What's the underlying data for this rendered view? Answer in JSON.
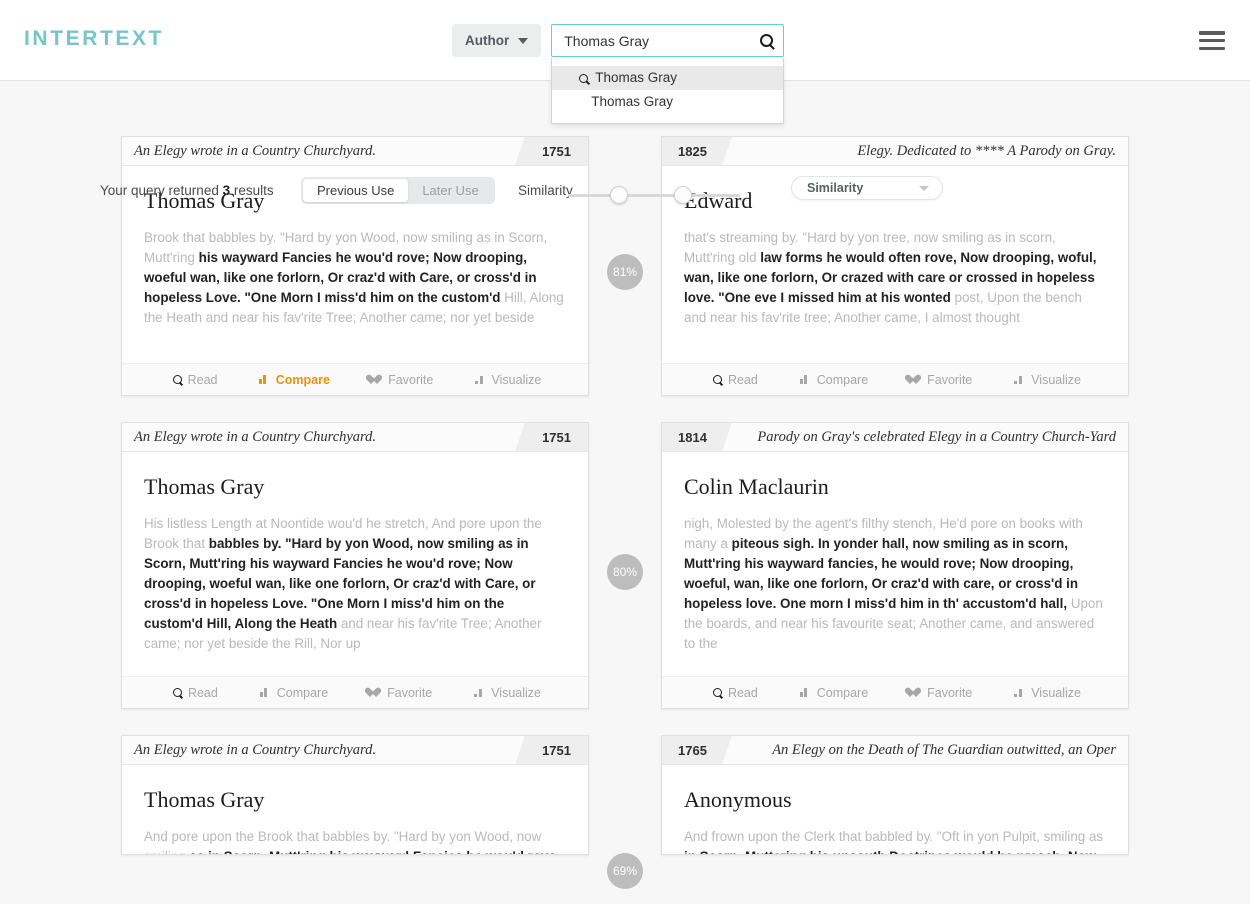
{
  "header": {
    "logo": "INTERTEXT",
    "author_filter_label": "Author",
    "search_value": "Thomas Gray",
    "search_placeholder": "Search",
    "search_icon": "search-icon",
    "menu_icon": "hamburger-menu-icon",
    "suggestions": [
      {
        "label": "Thomas Gray",
        "icon": "search-icon",
        "active": true
      },
      {
        "label": "Thomas Gray",
        "icon": "",
        "active": false
      }
    ]
  },
  "toolbar": {
    "results_prefix": "Your query returned",
    "results_count": "3",
    "results_suffix": "results",
    "toggle": {
      "previous_label": "Previous Use",
      "later_label": "Later Use",
      "selected": "Previous Use"
    },
    "similarity_label": "Similarity",
    "sort_value": "Similarity"
  },
  "colors": {
    "brand": "#76c5cd",
    "accent": "#e8930a",
    "badge": "#bdbdbd",
    "focus_border": "#63cfd8"
  },
  "actions": {
    "read": "Read",
    "compare": "Compare",
    "favorite": "Favorite",
    "visualize": "Visualize"
  },
  "results": [
    {
      "score": "81%",
      "left": {
        "title": "An Elegy wrote in a Country Churchyard.",
        "year": "1751",
        "author": "Thomas Gray",
        "excerpt": [
          {
            "t": "Brook that babbles by. \"Hard by yon Wood, now smiling as in Scorn, Mutt'ring ",
            "b": false
          },
          {
            "t": "his wayward Fancies he wou'd rove; Now drooping, woeful wan, like one forlorn, Or craz'd with Care, or cross'd in hopeless Love. \"One Morn I miss'd him on the custom'd",
            "b": true
          },
          {
            "t": " Hill, Along the Heath and near his fav'rite Tree; Another came; nor yet beside",
            "b": false
          }
        ],
        "compare_active": true
      },
      "right": {
        "title": "Elegy. Dedicated to **** A Parody on Gray.",
        "year": "1825",
        "author": "Edward",
        "excerpt": [
          {
            "t": "that's streaming by. \"Hard by yon tree, now smiling as in scorn, Mutt'ring old ",
            "b": false
          },
          {
            "t": "law forms he would often rove, Now drooping, woful, wan, like one forlorn, Or crazed with care or crossed in hopeless love. \"One eve I missed him at his wonted",
            "b": true
          },
          {
            "t": " post, Upon the bench and near his fav'rite tree; Another came, I almost thought",
            "b": false
          }
        ],
        "compare_active": false
      }
    },
    {
      "score": "80%",
      "left": {
        "title": "An Elegy wrote in a Country Churchyard.",
        "year": "1751",
        "author": "Thomas Gray",
        "excerpt": [
          {
            "t": "His listless Length at Noontide wou'd he stretch, And pore upon the Brook that ",
            "b": false
          },
          {
            "t": "babbles by. \"Hard by yon Wood, now smiling as in Scorn, Mutt'ring his wayward Fancies he wou'd rove; Now drooping, woeful wan, like one forlorn, Or craz'd with Care, or cross'd in hopeless Love. \"One Morn I miss'd him on the custom'd Hill, Along the Heath",
            "b": true
          },
          {
            "t": " and near his fav'rite Tree; Another came; nor yet beside the Rill, Nor up",
            "b": false
          }
        ],
        "compare_active": false
      },
      "right": {
        "title": "Parody on Gray's celebrated Elegy in a Country Church-Yard",
        "year": "1814",
        "author": "Colin Maclaurin",
        "excerpt": [
          {
            "t": "nigh, Molested by the agent's filthy stench, He'd pore on books with many a ",
            "b": false
          },
          {
            "t": "piteous sigh. In yonder hall, now smiling as in scorn, Mutt'ring his wayward fancies, he would rove; Now drooping, woeful, wan, like one forlorn, Or craz'd with care, or cross'd in hopeless love. One morn I miss'd him in th' accustom'd hall,",
            "b": true
          },
          {
            "t": " Upon the boards, and near his favourite seat; Another came, and answered to the",
            "b": false
          }
        ],
        "compare_active": false
      }
    },
    {
      "score": "69%",
      "left": {
        "title": "An Elegy wrote in a Country Churchyard.",
        "year": "1751",
        "author": "Thomas Gray",
        "excerpt": [
          {
            "t": "And pore upon the Brook that babbles by. \"Hard by yon Wood, now smiling ",
            "b": false
          },
          {
            "t": "as in Scorn, Mutt'ring his wayward Fancies he wou'd rove;",
            "b": true
          }
        ],
        "compare_active": false
      },
      "right": {
        "title": "An Elegy on the Death of The Guardian outwitted, an Oper",
        "year": "1765",
        "author": "Anonymous",
        "excerpt": [
          {
            "t": "And frown upon the Clerk that babbled by. \"Oft in yon Pulpit, smiling as ",
            "b": false
          },
          {
            "t": "in Scorn, Muttering his uncouth Doctrines would he preach, Now",
            "b": true
          }
        ],
        "compare_active": false
      }
    }
  ]
}
